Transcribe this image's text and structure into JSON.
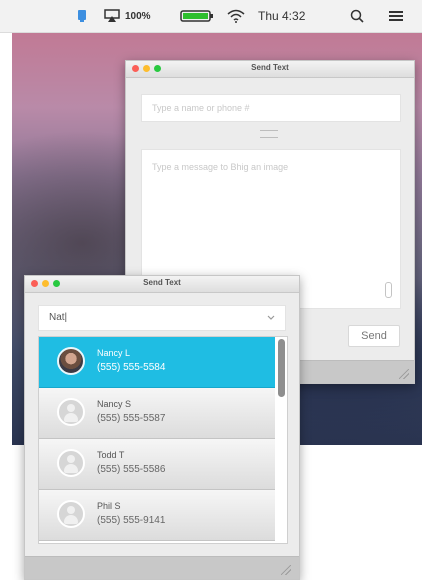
{
  "menubar": {
    "battery": "100%",
    "clock": "Thu 4:32"
  },
  "back_window": {
    "title": "Send Text",
    "recipient_placeholder": "Type a name or phone #",
    "message_placeholder": "Type a message to Bhig an image",
    "send_label": "Send"
  },
  "front_window": {
    "title": "Send Text",
    "search_value": "Nat|"
  },
  "contacts": [
    {
      "name": "Nancy L",
      "phone": "(555) 555-5584",
      "selected": true
    },
    {
      "name": "Nancy S",
      "phone": "(555) 555-5587",
      "selected": false
    },
    {
      "name": "Todd T",
      "phone": "(555) 555-5586",
      "selected": false
    },
    {
      "name": "Phil S",
      "phone": "(555) 555-9141",
      "selected": false
    }
  ],
  "colors": {
    "selection": "#1fbde3",
    "battery_fill": "#2fbf2f"
  }
}
